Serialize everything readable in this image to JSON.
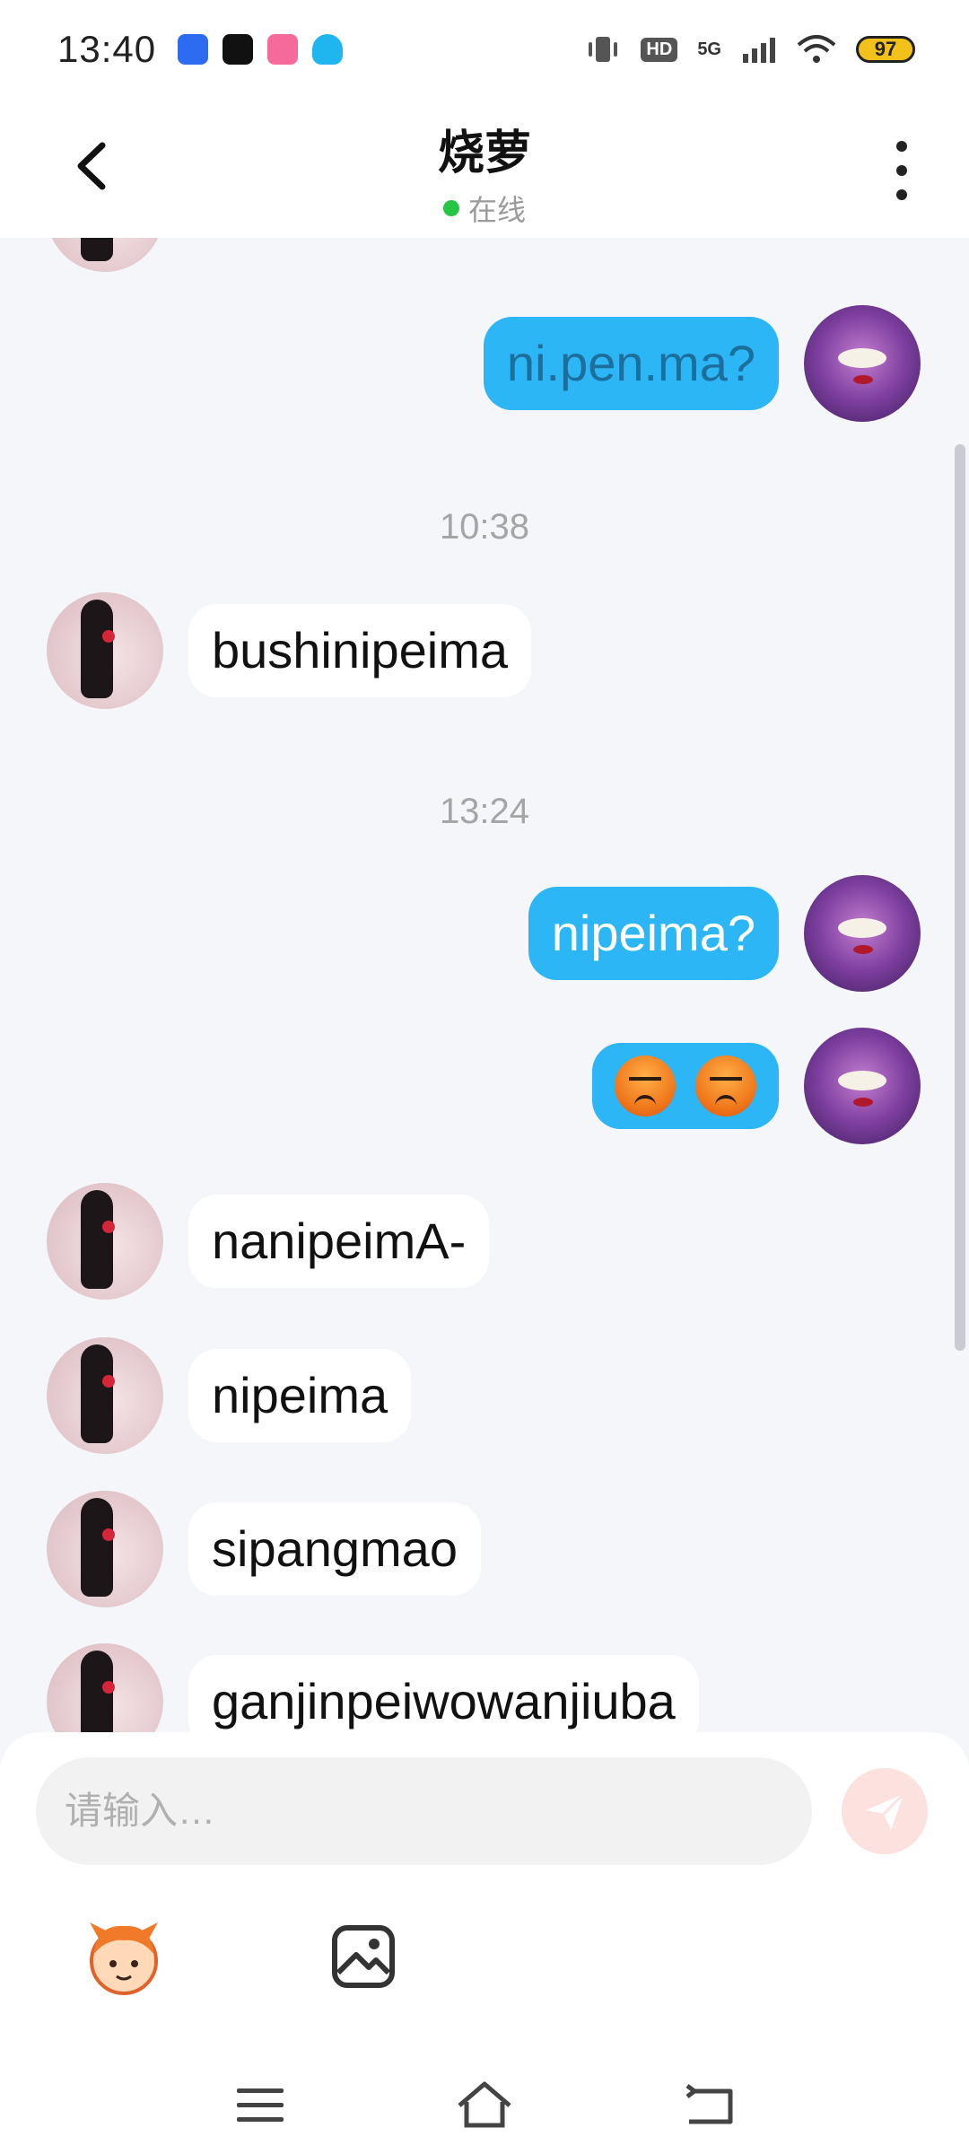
{
  "status_bar": {
    "time": "13:40",
    "network_label": "HD",
    "signal_label": "5G",
    "battery_level": "97",
    "app_icons": [
      "shield-app-icon",
      "tiktok-app-icon",
      "bilibili-app-icon",
      "qq-app-icon"
    ]
  },
  "header": {
    "title": "烧萝",
    "presence": "在线"
  },
  "messages": [
    {
      "sender": "me",
      "text": "ni.pen.ma?"
    },
    {
      "type": "timestamp",
      "text": "10:38"
    },
    {
      "sender": "other",
      "text": "bushinipeima"
    },
    {
      "type": "timestamp",
      "text": "13:24"
    },
    {
      "sender": "me",
      "text": "nipeima?"
    },
    {
      "sender": "me",
      "emoji": [
        "angry-face",
        "angry-face"
      ]
    },
    {
      "sender": "other",
      "text": "nanipeimA-"
    },
    {
      "sender": "other",
      "text": "nipeima"
    },
    {
      "sender": "other",
      "text": "sipangmao"
    },
    {
      "sender": "other",
      "text": "ganjinpeiwowanjiuba"
    }
  ],
  "input": {
    "placeholder": "请输入…"
  },
  "colors": {
    "accent": "#2db6f5",
    "presence_dot": "#28c445",
    "send_button": "#fbe2df",
    "chat_background": "#f4f6f9"
  }
}
